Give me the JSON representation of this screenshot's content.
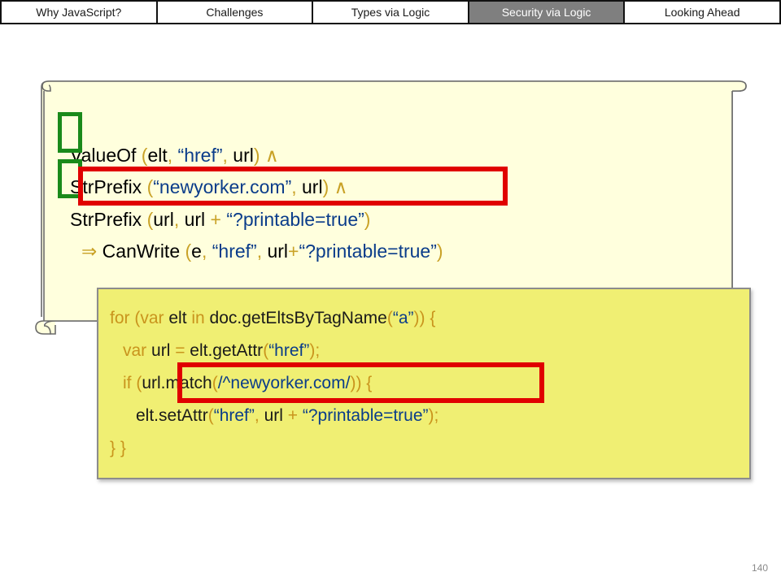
{
  "nav": {
    "tabs": [
      {
        "label": "Why JavaScript?",
        "active": false
      },
      {
        "label": "Challenges",
        "active": false
      },
      {
        "label": "Types via Logic",
        "active": false
      },
      {
        "label": "Security via Logic",
        "active": true
      },
      {
        "label": "Looking Ahead",
        "active": false
      }
    ]
  },
  "logic": {
    "line1": {
      "fn": "ValueOf",
      "open": " (",
      "a1": "elt",
      "sep1": ", ",
      "a2": "“href”",
      "sep2": ", ",
      "a3": "url",
      "close": ") ",
      "and": "∧"
    },
    "line2": {
      "fn": "StrPrefix",
      "open": " (",
      "a1": "“newyorker.com”",
      "sep1": ", ",
      "a2": "url",
      "close": ") ",
      "and": "∧"
    },
    "line3": {
      "fn": "StrPrefix",
      "open": " (",
      "a1": "url",
      "sep1": ", ",
      "a2": "url",
      "plus": " + ",
      "a3": "“?printable=true”",
      "close": ")"
    },
    "line4": {
      "implies": "⇒",
      "fn": " CanWrite",
      "open": " (",
      "a1": "e",
      "sep1": ", ",
      "a2": "“href”",
      "sep2": ", ",
      "a3": "url",
      "plus": "+",
      "a4": "“?printable=true”",
      "close": ")"
    }
  },
  "code": {
    "line1": {
      "kw1": "for (var ",
      "v": "elt",
      "kw2": " in ",
      "call": "doc.getEltsByTagName",
      "open": "(",
      "str": "“a”",
      "close": ")) {"
    },
    "line2": {
      "kw1": "var ",
      "v": "url",
      "eq": " = ",
      "call": "elt.getAttr",
      "open": "(",
      "str": "“href”",
      "close": ");"
    },
    "line3": {
      "kw1": "if (",
      "v": "url.",
      "m": "match",
      "open": "(",
      "re": "/^newyorker.com/",
      "close": ")) {"
    },
    "line4": {
      "call": "elt.setAttr",
      "open": "(",
      "str1": "“href”",
      "sep": ", ",
      "v": "url",
      "plus": " + ",
      "str2": "“?printable=true”",
      "close": ");"
    },
    "line5": {
      "text": "} }"
    }
  },
  "page_number": "140",
  "colors": {
    "keyword": "#c9941d",
    "string": "#0a3c8a",
    "highlight": "#e00000",
    "check": "#1a8a1a",
    "panel": "#f0ef73",
    "scroll": "#ffffdd",
    "active_tab": "#7f7f7f"
  }
}
